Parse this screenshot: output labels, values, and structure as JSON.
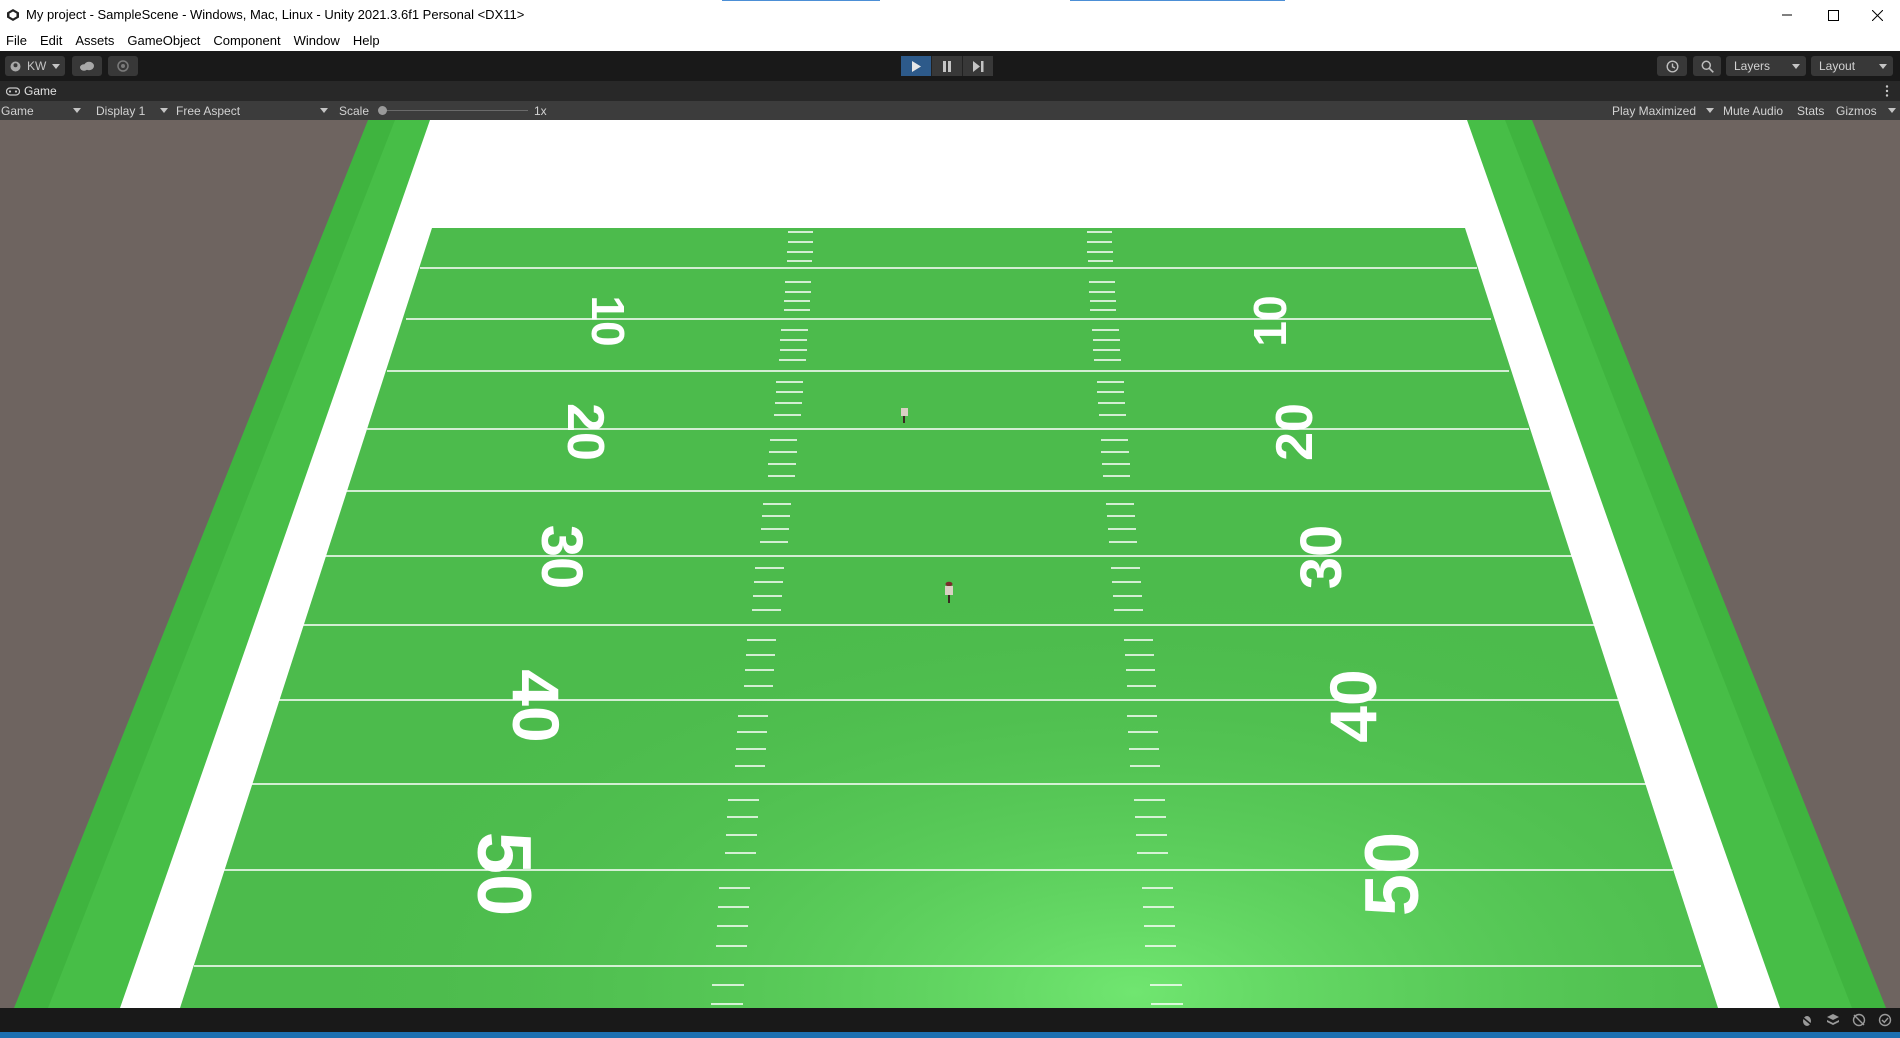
{
  "window": {
    "title": "My project - SampleScene - Windows, Mac, Linux - Unity 2021.3.6f1 Personal <DX11>",
    "controls": [
      "minimize-icon",
      "maximize-icon",
      "close-icon"
    ]
  },
  "menu": {
    "items": [
      {
        "label": "File"
      },
      {
        "label": "Edit"
      },
      {
        "label": "Assets"
      },
      {
        "label": "GameObject"
      },
      {
        "label": "Component"
      },
      {
        "label": "Window"
      },
      {
        "label": "Help"
      }
    ]
  },
  "toolbar": {
    "account_label": "KW",
    "play_state": "playing",
    "layers_label": "Layers",
    "layout_label": "Layout"
  },
  "game_tab": {
    "label": "Game"
  },
  "game_view_bar": {
    "view_mode": "Game",
    "display": "Display 1",
    "aspect": "Free Aspect",
    "scale_label": "Scale",
    "scale_value": "1x",
    "play_mode": "Play Maximized",
    "mute_audio": "Mute Audio",
    "stats": "Stats",
    "gizmos": "Gizmos"
  },
  "field": {
    "left_numbers": [
      "10",
      "20",
      "30",
      "40",
      "50"
    ],
    "right_numbers": [
      "10",
      "20",
      "30",
      "40",
      "50"
    ],
    "colors": {
      "grass": "#4cbb4c",
      "border_grass": "#3fb43f",
      "background": "#6e6460",
      "lines": "#ffffff"
    }
  }
}
